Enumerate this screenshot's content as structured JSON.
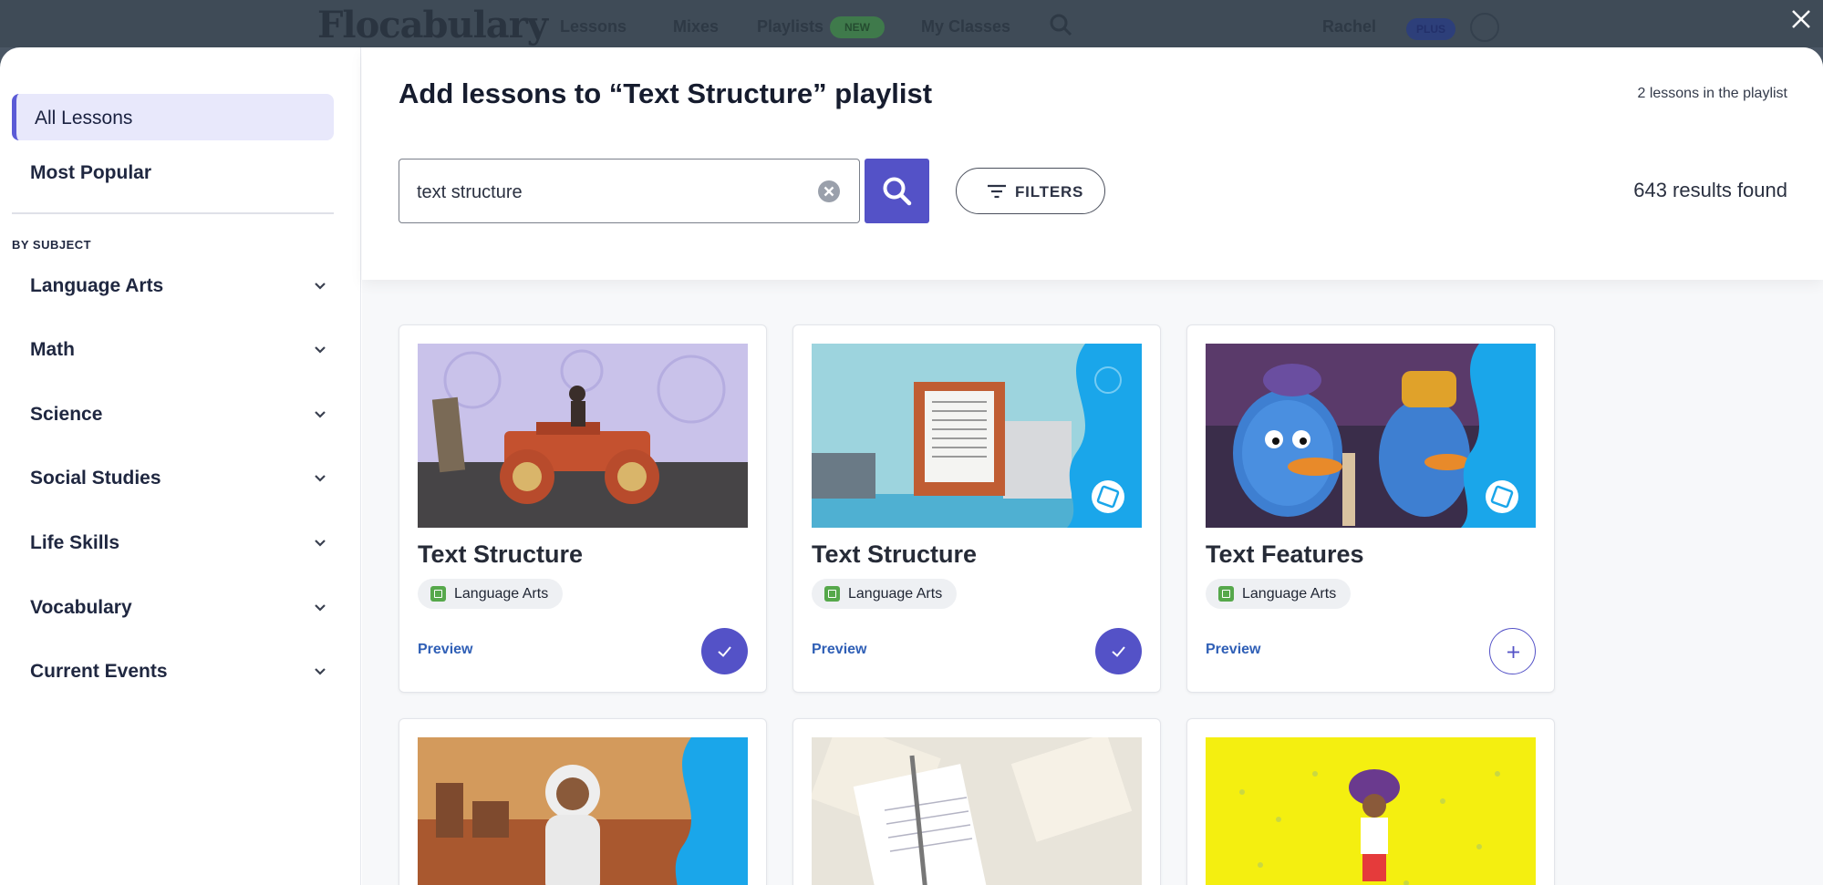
{
  "background_nav": {
    "logo": "Flocabulary",
    "items": [
      "Lessons",
      "Mixes",
      "Playlists",
      "My Classes"
    ],
    "new_badge": "NEW",
    "user": "Rachel",
    "plus_badge": "PLUS"
  },
  "sidebar": {
    "active_item": "All Lessons",
    "most_popular": "Most Popular",
    "by_subject_label": "BY SUBJECT",
    "subjects": [
      "Language Arts",
      "Math",
      "Science",
      "Social Studies",
      "Life Skills",
      "Vocabulary",
      "Current Events"
    ]
  },
  "header": {
    "title": "Add lessons to “Text Structure” playlist",
    "playlist_count": "2 lessons in the playlist"
  },
  "search": {
    "value": "text structure",
    "filters_label": "FILTERS",
    "results_text": "643 results found"
  },
  "cards": [
    {
      "title": "Text Structure",
      "subject": "Language Arts",
      "preview": "Preview",
      "added": true
    },
    {
      "title": "Text Structure",
      "subject": "Language Arts",
      "preview": "Preview",
      "added": true
    },
    {
      "title": "Text Features",
      "subject": "Language Arts",
      "preview": "Preview",
      "added": false
    }
  ],
  "colors": {
    "accent": "#5452c7",
    "sidebar_active_bg": "#e8e8fb",
    "link": "#2f5fb6",
    "tag_icon": "#56a84b",
    "nearpod_blue": "#1aa6ea"
  }
}
